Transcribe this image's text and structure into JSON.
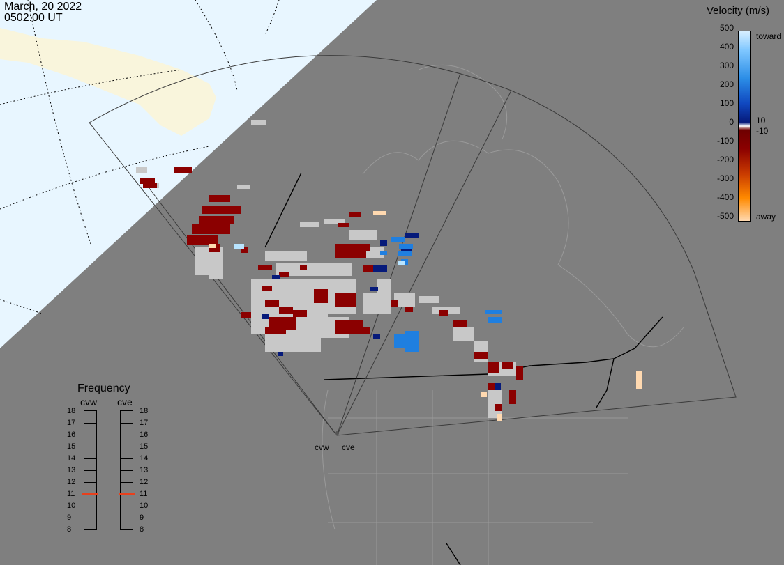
{
  "header": {
    "date": "March, 20 2022",
    "time": "0502:00 UT"
  },
  "velocity_legend": {
    "title": "Velocity (m/s)",
    "ticks": [
      "500",
      "400",
      "300",
      "200",
      "100",
      "0",
      "-100",
      "-200",
      "-300",
      "-400",
      "-500"
    ],
    "toward_label": "toward",
    "away_label": "away",
    "near_zero_pos": "10",
    "near_zero_neg": "-10",
    "colors": {
      "toward_light": "#b8e4ff",
      "toward_mid": "#1f7fe0",
      "toward_dark": "#061a7a",
      "ground_scatter": "#c8c8c8",
      "away_dark": "#8b0000",
      "away_mid": "#e85a00",
      "away_light": "#ffd9b0"
    }
  },
  "frequency_legend": {
    "title": "Frequency",
    "radars": [
      "cvw",
      "cve"
    ],
    "levels": [
      "18",
      "17",
      "16",
      "15",
      "14",
      "13",
      "12",
      "11",
      "10",
      "9",
      "8"
    ],
    "selected": {
      "cvw": 11,
      "cve": 11
    },
    "marker_color": "#e8401c"
  },
  "radar_sites": {
    "west": "cvw",
    "east": "cve"
  },
  "map_colors": {
    "land": "#7f7f7f",
    "daylight_ocean": "#e8f6ff",
    "daylight_land": "#f9f5dc",
    "boundary": "#000000",
    "grid": "#999999"
  }
}
